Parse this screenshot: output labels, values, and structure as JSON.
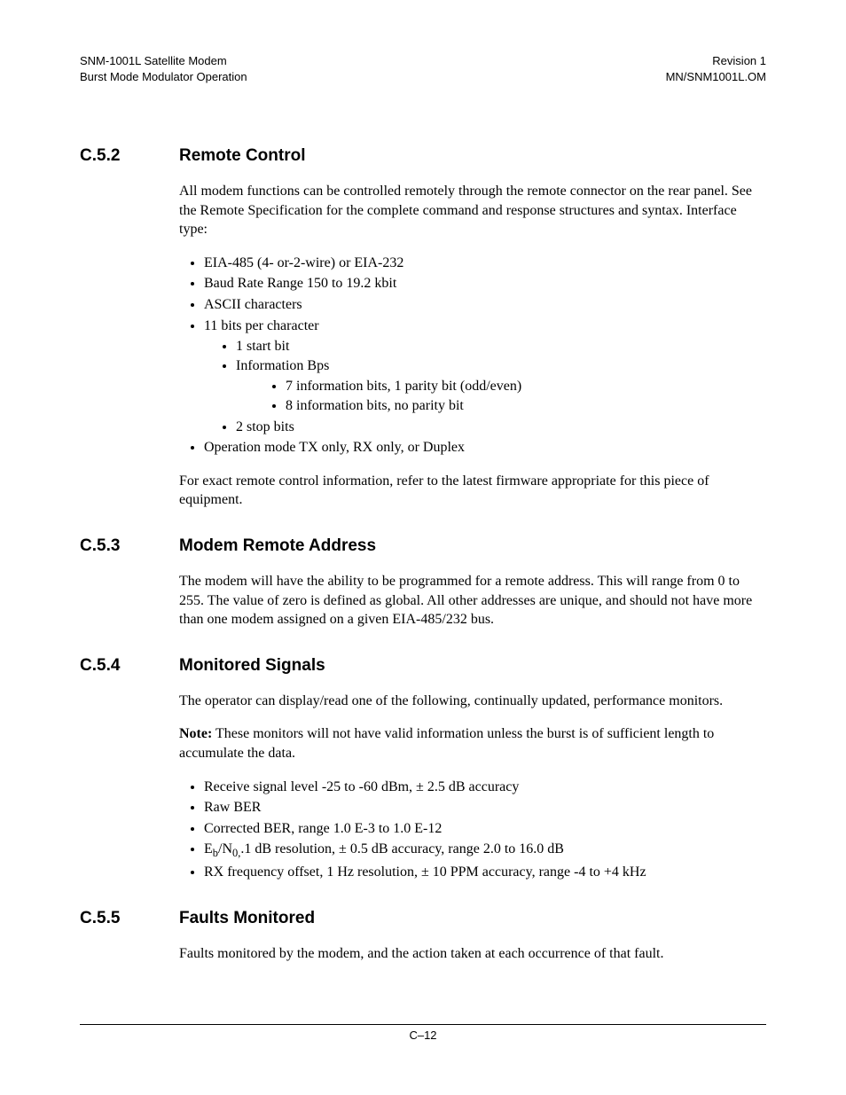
{
  "header": {
    "left1": "SNM-1001L Satellite Modem",
    "left2": "Burst Mode Modulator Operation",
    "right1": "Revision 1",
    "right2": "MN/SNM1001L.OM"
  },
  "sections": {
    "s1": {
      "num": "C.5.2",
      "title": "Remote Control",
      "p1": "All modem functions can be controlled remotely through the remote connector on the rear panel. See the Remote Specification for the complete command and response structures and syntax. Interface type:",
      "b1": "EIA-485 (4- or-2-wire) or EIA-232",
      "b2": "Baud Rate Range 150 to 19.2 kbit",
      "b3": "ASCII characters",
      "b4": "11 bits per character",
      "b4a": "1 start bit",
      "b4b": "Information Bps",
      "b4b1": "7 information bits, 1 parity bit (odd/even)",
      "b4b2": "8 information bits, no parity bit",
      "b4c": "2 stop bits",
      "b5": "Operation mode TX only, RX only, or Duplex",
      "p2": "For exact remote control information, refer to the latest firmware appropriate for this piece of equipment."
    },
    "s2": {
      "num": "C.5.3",
      "title": "Modem Remote Address",
      "p1": "The modem will have the ability to be programmed for a remote address. This will range from 0 to 255. The value of zero is defined as global. All other addresses are unique, and should not have more than one modem assigned on a given EIA-485/232 bus."
    },
    "s3": {
      "num": "C.5.4",
      "title": "Monitored Signals",
      "p1": "The operator can display/read one of the following, continually updated, performance monitors.",
      "note_label": "Note:",
      "note_text": " These monitors will not have valid information unless the burst is of sufficient length to accumulate the data.",
      "b1": "Receive signal level -25 to -60 dBm, ± 2.5 dB accuracy",
      "b2": "Raw BER",
      "b3": "Corrected BER, range 1.0 E-3 to 1.0 E-12",
      "b4_pre": "E",
      "b4_sub1": "b",
      "b4_mid": "/N",
      "b4_sub2": "0,",
      "b4_post": ".1 dB resolution, ± 0.5 dB accuracy, range 2.0 to 16.0 dB",
      "b5": "RX frequency offset, 1 Hz resolution, ± 10 PPM accuracy, range -4 to +4 kHz"
    },
    "s4": {
      "num": "C.5.5",
      "title": "Faults Monitored",
      "p1": "Faults monitored by the modem, and the action taken at each occurrence of that fault."
    }
  },
  "footer": {
    "page": "C–12"
  }
}
